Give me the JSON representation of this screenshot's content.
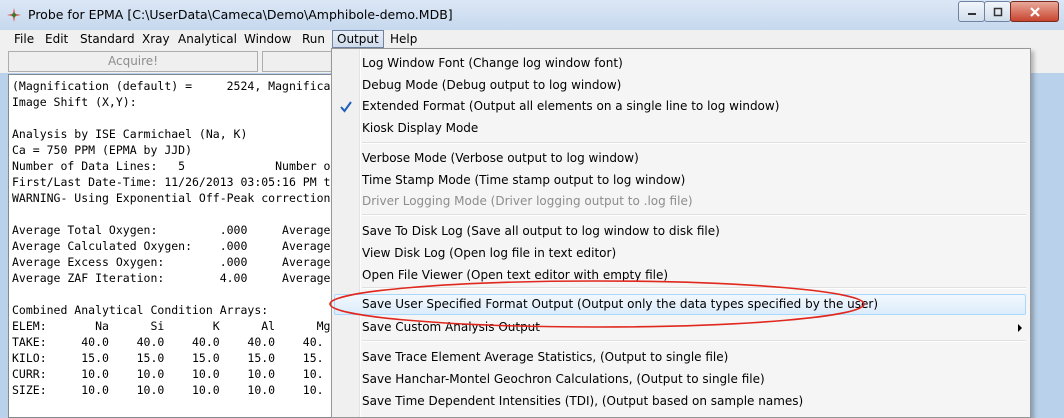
{
  "window": {
    "title": "Probe for EPMA [C:\\UserData\\Cameca\\Demo\\Amphibole-demo.MDB]"
  },
  "menubar": [
    "File",
    "Edit",
    "Standard",
    "Xray",
    "Analytical",
    "Window",
    "Run",
    "Output",
    "Help"
  ],
  "toolbar": {
    "acquire_label": "Acquire!"
  },
  "log_lines": [
    "(Magnification (default) =     2524, Magnifica",
    "Image Shift (X,Y):",
    "",
    "Analysis by ISE Carmichael (Na, K)",
    "Ca = 750 PPM (EPMA by JJD)",
    "Number of Data Lines:   5             Number o",
    "First/Last Date-Time: 11/26/2013 03:05:16 PM t",
    "WARNING- Using Exponential Off-Peak correction",
    "",
    "Average Total Oxygen:         .000     Average",
    "Average Calculated Oxygen:    .000     Average",
    "Average Excess Oxygen:        .000     Average",
    "Average ZAF Iteration:        4.00     Average",
    "",
    "Combined Analytical Condition Arrays:",
    "ELEM:       Na      Si       K      Al      Mg",
    "TAKE:     40.0    40.0    40.0    40.0    40.",
    "KILO:     15.0    15.0    15.0    15.0    15.",
    "CURR:     10.0    10.0    10.0    10.0    10.",
    "SIZE:     10.0    10.0    10.0    10.0    10."
  ],
  "output_menu": [
    {
      "label": "Log Window Font (Change log window font)",
      "checked": false,
      "disabled": false
    },
    {
      "label": "Debug Mode (Debug output to log window)",
      "checked": false,
      "disabled": false
    },
    {
      "label": "Extended Format (Output all elements on a single line to log window)",
      "checked": true,
      "disabled": false
    },
    {
      "label": "Kiosk Display Mode",
      "checked": false,
      "disabled": false
    },
    {
      "label": "Verbose Mode (Verbose output to log window)",
      "checked": false,
      "disabled": false
    },
    {
      "label": "Time Stamp Mode (Time stamp output to log window)",
      "checked": false,
      "disabled": false
    },
    {
      "label": "Driver Logging Mode (Driver logging output to .log file)",
      "checked": false,
      "disabled": true
    },
    {
      "label": "Save To Disk Log (Save all output to log window to disk file)",
      "checked": false,
      "disabled": false
    },
    {
      "label": "View Disk Log (Open log file in text editor)",
      "checked": false,
      "disabled": false
    },
    {
      "label": "Open File Viewer (Open text editor with empty file)",
      "checked": false,
      "disabled": false
    },
    {
      "label": "Save User Specified Format Output (Output only the data types specified by the user)",
      "checked": false,
      "disabled": false,
      "highlighted": true
    },
    {
      "label": "Save Custom Analysis Output",
      "checked": false,
      "disabled": false,
      "submenu": true
    },
    {
      "label": "Save Trace Element Average Statistics, (Output to single file)",
      "checked": false,
      "disabled": false
    },
    {
      "label": "Save Hanchar-Montel Geochron Calculations, (Output to single file)",
      "checked": false,
      "disabled": false
    },
    {
      "label": "Save Time Dependent Intensities (TDI), (Output based on sample names)",
      "checked": false,
      "disabled": false
    }
  ],
  "colors": {
    "annotation_oval": "#e0281e",
    "highlight": "#dcecfb",
    "check": "#1f5fb8"
  }
}
